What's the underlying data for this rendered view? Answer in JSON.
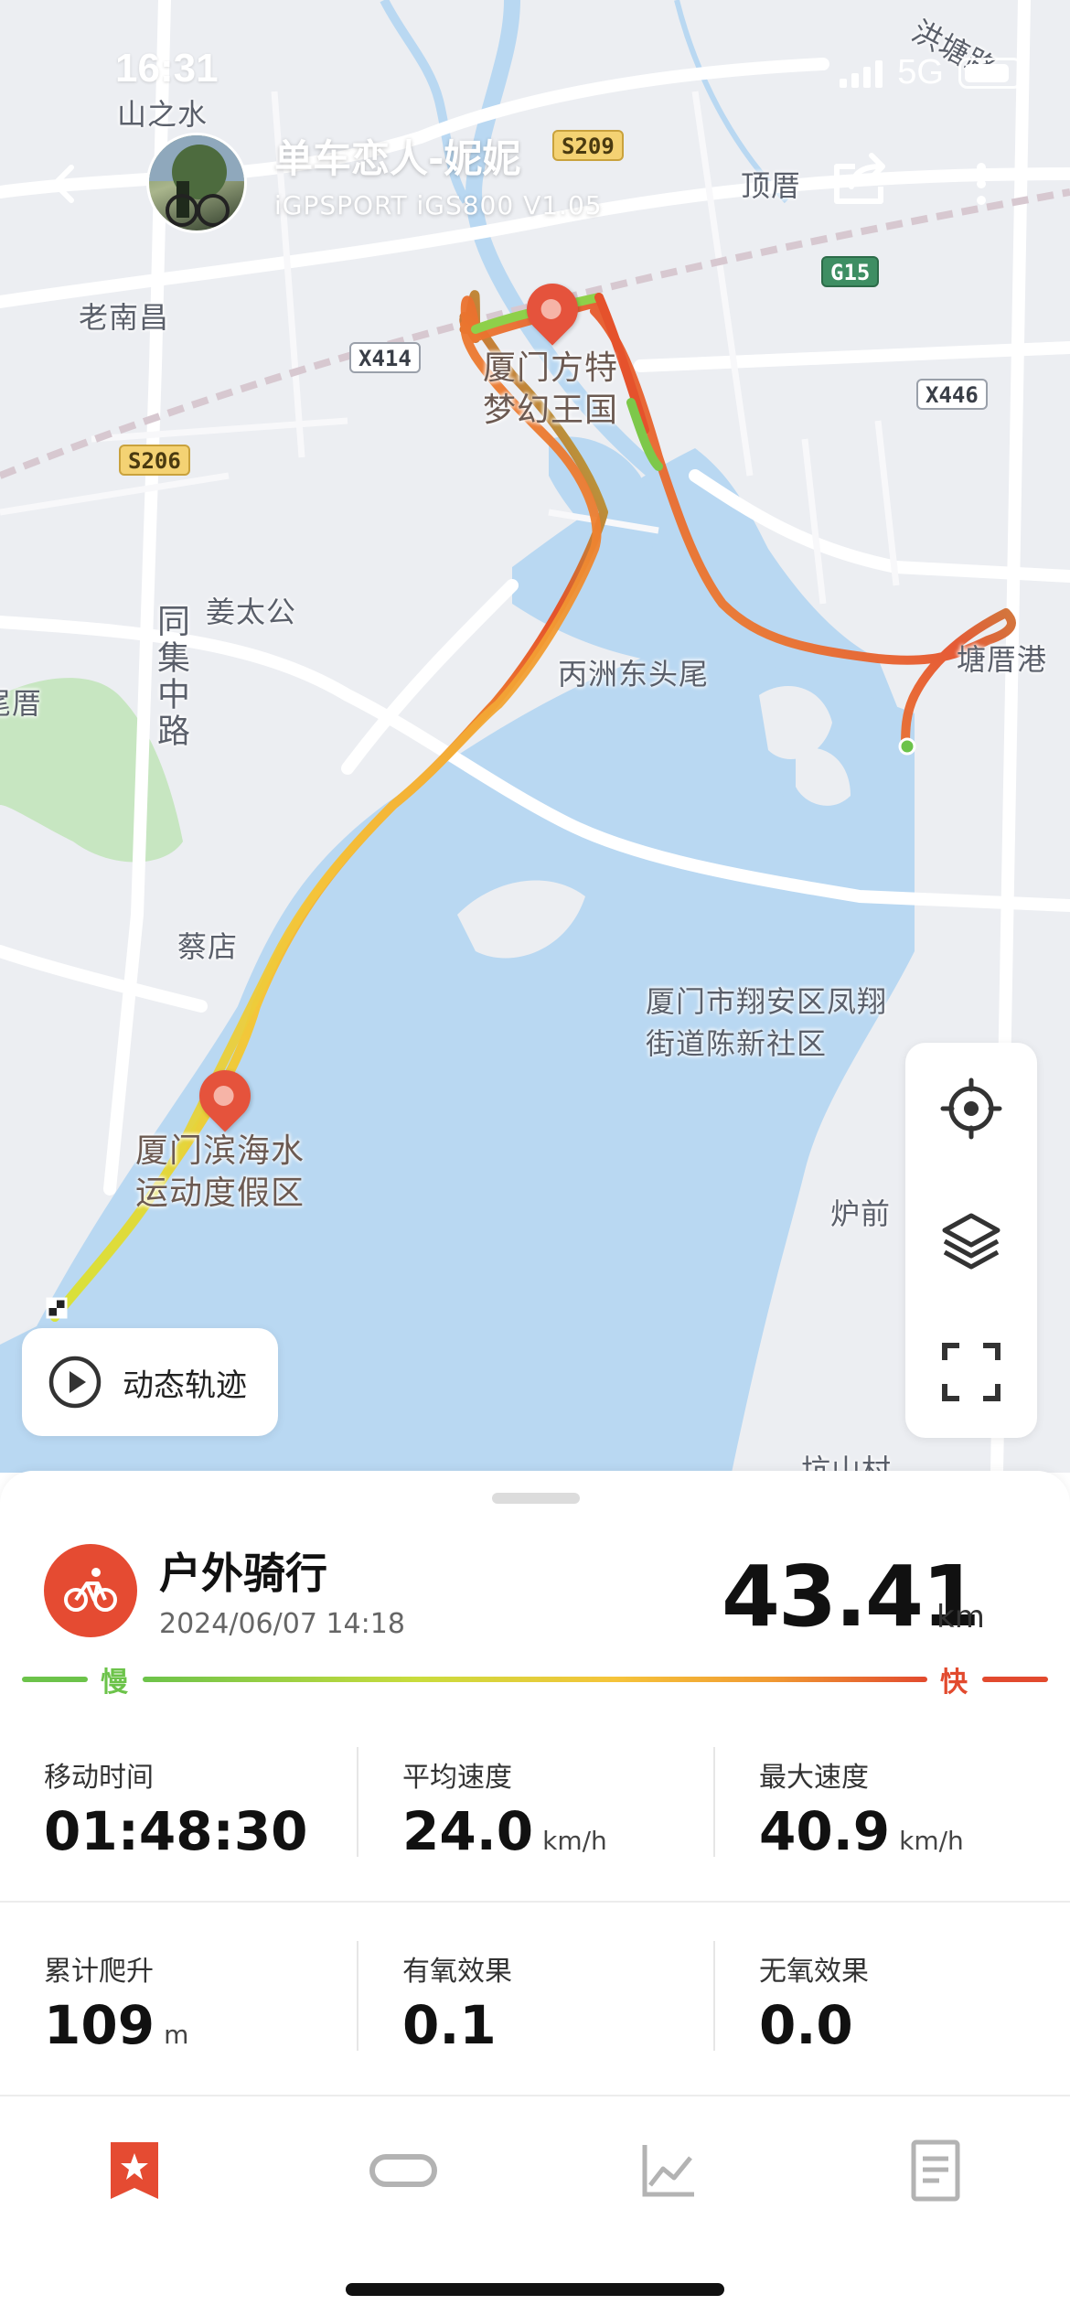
{
  "status_bar": {
    "time": "16:31",
    "network": "5G"
  },
  "header": {
    "user_name": "单车恋人-妮妮",
    "device": "iGPSPORT iGS800 V1.05",
    "icons": [
      "back-arrow-icon",
      "share-icon",
      "more-vertical-icon"
    ]
  },
  "map": {
    "labels": {
      "shanzhishui": "山之水",
      "hongtanglu": "洪塘路",
      "dingcuo": "顶厝",
      "laonanchang": "老南昌",
      "jiangtaigong": "姜太公",
      "tongjizhonglu": "同集中路",
      "weicuo": "尾厝",
      "bingzhou": "丙洲东头尾",
      "tangcuogang": "塘厝港",
      "caidian": "蔡店",
      "xiamen_xiangan": "厦门市翔安区凤翔街道陈新社区",
      "luqian": "炉前",
      "poi_fangte": "厦门方特梦幻王国",
      "poi_binhai": "厦门滨海水运动度假区",
      "bottom_cut": "坑山村"
    },
    "roads": {
      "s209": "S209",
      "s206": "S206",
      "g15": "G15",
      "x414": "X414",
      "x446": "X446"
    },
    "controls": [
      "locate-icon",
      "layers-icon",
      "fullscreen-icon"
    ],
    "track_button": "动态轨迹"
  },
  "summary": {
    "sport": "户外骑行",
    "datetime": "2024/06/07 14:18",
    "distance": "43.41",
    "distance_unit": "km",
    "legend_slow": "慢",
    "legend_fast": "快",
    "colors": {
      "accent": "#e54b32",
      "slow": "#6cc34a",
      "fast": "#e24a2e"
    }
  },
  "stats": [
    {
      "label": "移动时间",
      "value": "01:48:30",
      "unit": ""
    },
    {
      "label": "平均速度",
      "value": "24.0",
      "unit": "km/h"
    },
    {
      "label": "最大速度",
      "value": "40.9",
      "unit": "km/h"
    },
    {
      "label": "累计爬升",
      "value": "109",
      "unit": "m"
    },
    {
      "label": "有氧效果",
      "value": "0.1",
      "unit": ""
    },
    {
      "label": "无氧效果",
      "value": "0.0",
      "unit": ""
    }
  ],
  "tabbar": [
    "overview-star-icon",
    "segments-icon",
    "chart-icon",
    "details-icon"
  ]
}
